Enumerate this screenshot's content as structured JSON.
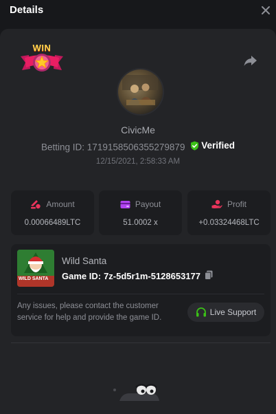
{
  "header": {
    "title": "Details"
  },
  "bet": {
    "username": "CivicMe",
    "betting_id_label": "Betting ID:",
    "betting_id": "1719158506355279879",
    "verified_label": "Verified",
    "timestamp": "12/15/2021, 2:58:33 AM",
    "badge_text": "WIN"
  },
  "stats": [
    {
      "label": "Amount",
      "value": "0.00066489LTC",
      "icon": "coins-icon"
    },
    {
      "label": "Payout",
      "value": "51.0002 x",
      "icon": "wallet-icon"
    },
    {
      "label": "Profit",
      "value": "+0.03324468LTC",
      "icon": "hand-coin-icon"
    }
  ],
  "game": {
    "name": "Wild Santa",
    "id_label": "Game ID:",
    "id": "7z-5d5r1m-5128653177",
    "thumb_text": "WILD SANTA"
  },
  "support": {
    "help_text": "Any issues, please contact the customer service for help and provide the game ID.",
    "button_label": "Live Support"
  },
  "colors": {
    "verified_shield": "#3bc117",
    "amount_icon": "#e9345b",
    "payout_icon": "#b043ef",
    "profit_icon": "#e9345b",
    "support_icon": "#3bc117"
  }
}
